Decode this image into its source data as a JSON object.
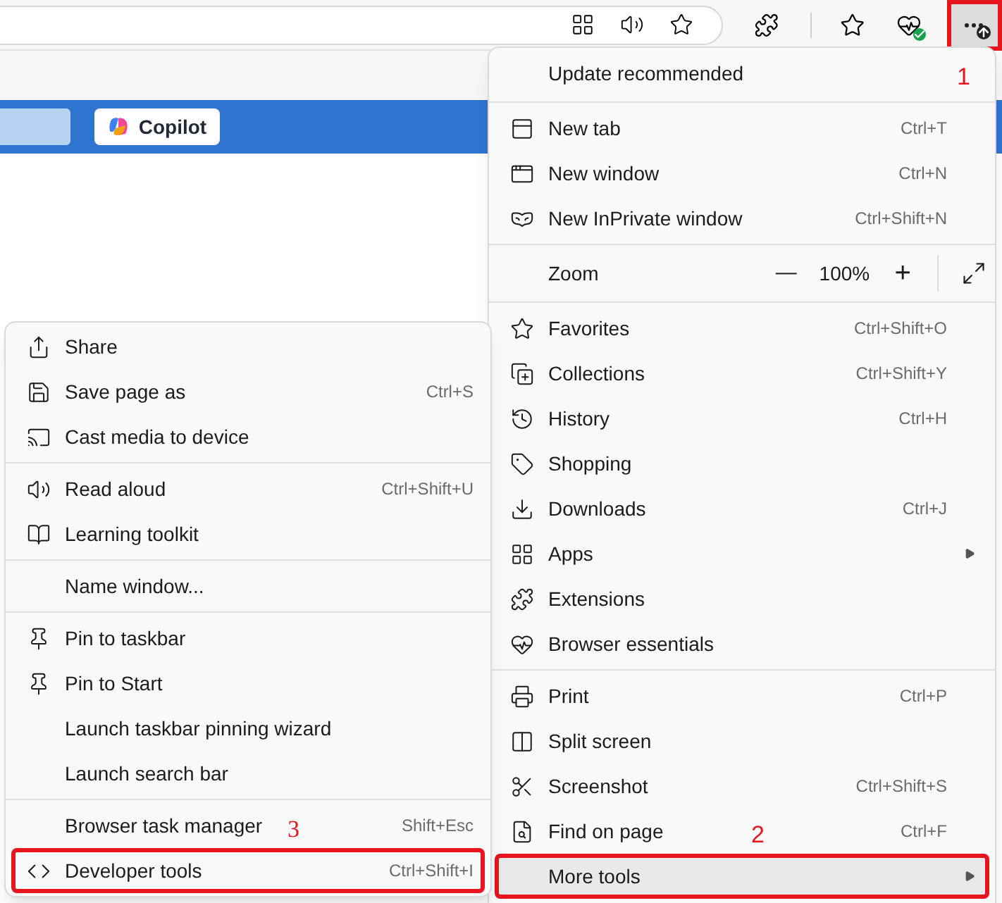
{
  "toolbar": {
    "more_button": {
      "highlighted": true,
      "marker": "1"
    }
  },
  "page": {
    "copilot_button": "Copilot"
  },
  "main_menu": {
    "items": [
      {
        "kind": "header",
        "label": "Update recommended",
        "selected": false,
        "highlighted": false
      },
      {
        "kind": "separator"
      },
      {
        "kind": "item",
        "label": "New tab",
        "shortcut": "Ctrl+T",
        "selected": false,
        "highlighted": false
      },
      {
        "kind": "item",
        "label": "New window",
        "shortcut": "Ctrl+N",
        "selected": false,
        "highlighted": false
      },
      {
        "kind": "item",
        "label": "New InPrivate window",
        "shortcut": "Ctrl+Shift+N",
        "selected": false,
        "highlighted": false
      },
      {
        "kind": "separator"
      },
      {
        "kind": "zoom",
        "label": "Zoom",
        "minus": "—",
        "value": "100%",
        "plus": "+",
        "selected": false,
        "highlighted": false
      },
      {
        "kind": "separator"
      },
      {
        "kind": "item",
        "label": "Favorites",
        "shortcut": "Ctrl+Shift+O",
        "selected": false,
        "highlighted": false
      },
      {
        "kind": "item",
        "label": "Collections",
        "shortcut": "Ctrl+Shift+Y",
        "selected": false,
        "highlighted": false
      },
      {
        "kind": "item",
        "label": "History",
        "shortcut": "Ctrl+H",
        "selected": false,
        "highlighted": false
      },
      {
        "kind": "item",
        "label": "Shopping",
        "selected": false,
        "highlighted": false
      },
      {
        "kind": "item",
        "label": "Downloads",
        "shortcut": "Ctrl+J",
        "selected": false,
        "highlighted": false
      },
      {
        "kind": "submenu",
        "label": "Apps",
        "selected": false,
        "highlighted": false
      },
      {
        "kind": "item",
        "label": "Extensions",
        "selected": false,
        "highlighted": false
      },
      {
        "kind": "item",
        "label": "Browser essentials",
        "selected": false,
        "highlighted": false
      },
      {
        "kind": "separator"
      },
      {
        "kind": "item",
        "label": "Print",
        "shortcut": "Ctrl+P",
        "selected": false,
        "highlighted": false
      },
      {
        "kind": "item",
        "label": "Split screen",
        "selected": false,
        "highlighted": false
      },
      {
        "kind": "item",
        "label": "Screenshot",
        "shortcut": "Ctrl+Shift+S",
        "selected": false,
        "highlighted": false
      },
      {
        "kind": "item",
        "label": "Find on page",
        "shortcut": "Ctrl+F",
        "selected": false,
        "highlighted": false,
        "marker": "2"
      },
      {
        "kind": "submenu",
        "label": "More tools",
        "selected": true,
        "highlighted": true
      }
    ]
  },
  "more_tools_menu": {
    "items": [
      {
        "kind": "item",
        "label": "Share",
        "selected": false,
        "highlighted": false
      },
      {
        "kind": "item",
        "label": "Save page as",
        "shortcut": "Ctrl+S",
        "selected": false,
        "highlighted": false
      },
      {
        "kind": "item",
        "label": "Cast media to device",
        "selected": false,
        "highlighted": false
      },
      {
        "kind": "separator"
      },
      {
        "kind": "item",
        "label": "Read aloud",
        "shortcut": "Ctrl+Shift+U",
        "selected": false,
        "highlighted": false
      },
      {
        "kind": "item",
        "label": "Learning toolkit",
        "selected": false,
        "highlighted": false
      },
      {
        "kind": "separator"
      },
      {
        "kind": "item",
        "label": "Name window...",
        "selected": false,
        "highlighted": false
      },
      {
        "kind": "separator"
      },
      {
        "kind": "item",
        "label": "Pin to taskbar",
        "selected": false,
        "highlighted": false
      },
      {
        "kind": "item",
        "label": "Pin to Start",
        "selected": false,
        "highlighted": false
      },
      {
        "kind": "item",
        "label": "Launch taskbar pinning wizard",
        "selected": false,
        "highlighted": false
      },
      {
        "kind": "item",
        "label": "Launch search bar",
        "selected": false,
        "highlighted": false
      },
      {
        "kind": "separator"
      },
      {
        "kind": "item",
        "label": "Browser task manager",
        "shortcut": "Shift+Esc",
        "selected": false,
        "highlighted": false,
        "marker": "3"
      },
      {
        "kind": "item",
        "label": "Developer tools",
        "shortcut": "Ctrl+Shift+I",
        "selected": false,
        "highlighted": true
      }
    ]
  }
}
